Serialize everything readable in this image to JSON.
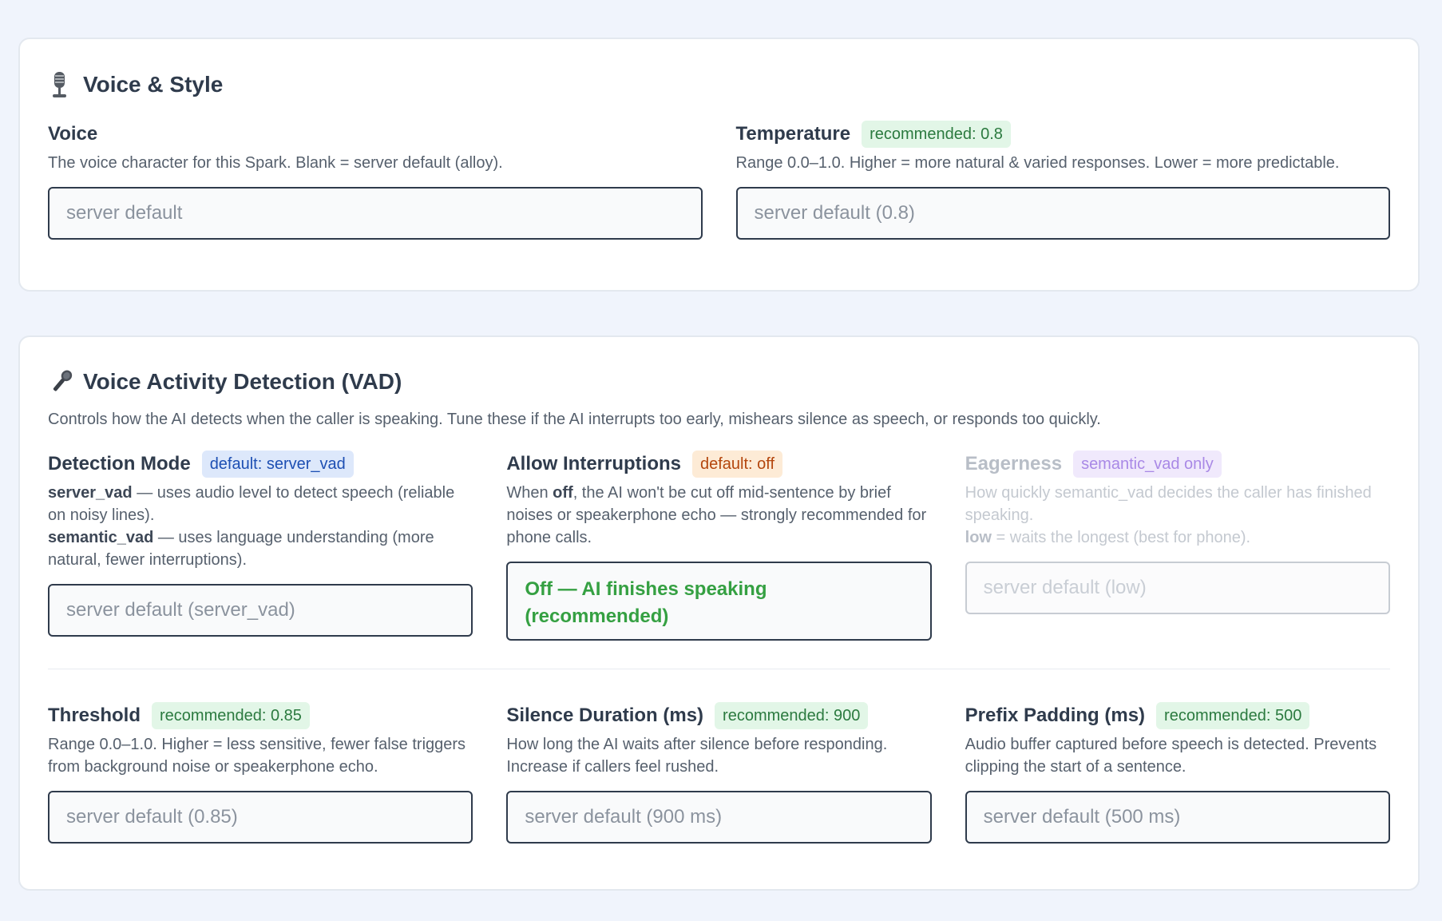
{
  "voice_style": {
    "title": "Voice & Style",
    "icon": "studio-microphone-icon",
    "voice": {
      "label": "Voice",
      "help": "The voice character for this Spark. Blank = server default (alloy).",
      "placeholder": "server default"
    },
    "temperature": {
      "label": "Temperature",
      "badge": "recommended: 0.8",
      "help": "Range 0.0–1.0. Higher = more natural & varied responses. Lower = more predictable.",
      "placeholder": "server default (0.8)"
    }
  },
  "vad": {
    "title": "Voice Activity Detection (VAD)",
    "icon": "microphone-icon",
    "description": "Controls how the AI detects when the caller is speaking. Tune these if the AI interrupts too early, mishears silence as speech, or responds too quickly.",
    "detection_mode": {
      "label": "Detection Mode",
      "badge": "default: server_vad",
      "help_1_term": "server_vad",
      "help_1_text": " — uses audio level to detect speech (reliable on noisy lines).",
      "help_2_term": "semantic_vad",
      "help_2_text": " — uses language understanding (more natural, fewer interruptions).",
      "placeholder": "server default (server_vad)"
    },
    "allow_interruptions": {
      "label": "Allow Interruptions",
      "badge": "default: off",
      "help_pre": "When ",
      "help_term": "off",
      "help_post": ", the AI won't be cut off mid-sentence by brief noises or speakerphone echo — strongly recommended for phone calls.",
      "selected": "Off — AI finishes speaking (recommended)"
    },
    "eagerness": {
      "label": "Eagerness",
      "badge": "semantic_vad only",
      "help_1": "How quickly semantic_vad decides the caller has finished speaking.",
      "help_2_term": "low",
      "help_2_text": " = waits the longest (best for phone).",
      "placeholder": "server default (low)"
    },
    "threshold": {
      "label": "Threshold",
      "badge": "recommended: 0.85",
      "help": "Range 0.0–1.0. Higher = less sensitive, fewer false triggers from background noise or speakerphone echo.",
      "placeholder": "server default (0.85)"
    },
    "silence_duration": {
      "label": "Silence Duration (ms)",
      "badge": "recommended: 900",
      "help": "How long the AI waits after silence before responding. Increase if callers feel rushed.",
      "placeholder": "server default (900 ms)"
    },
    "prefix_padding": {
      "label": "Prefix Padding (ms)",
      "badge": "recommended: 500",
      "help": "Audio buffer captured before speech is detected. Prevents clipping the start of a sentence.",
      "placeholder": "server default (500 ms)"
    }
  },
  "colors": {
    "background": "#f0f4fc",
    "accent_green": "#35a042",
    "badge_green_bg": "#e2f6e7",
    "badge_blue_bg": "#dde8fb",
    "badge_orange_bg": "#fdebd6",
    "badge_purple_bg": "#f0e9fc"
  }
}
